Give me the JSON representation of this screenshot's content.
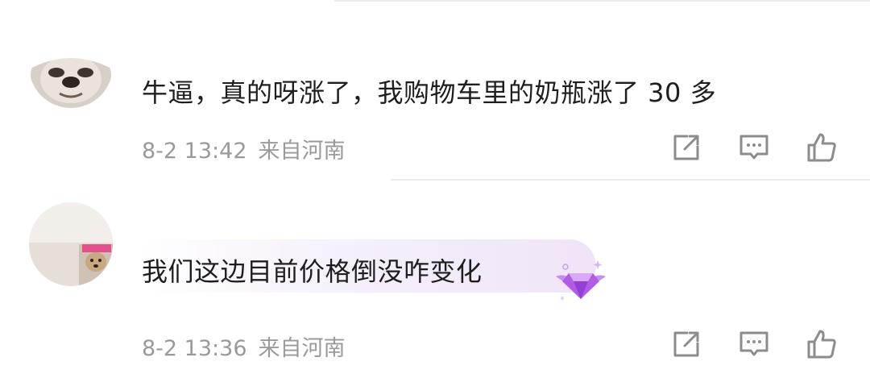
{
  "comments": [
    {
      "text": "牛逼，真的呀涨了，我购物车里的奶瓶涨了 30 多",
      "date": "8-2 13:42",
      "location": "来自河南"
    },
    {
      "text": "我们这边目前价格倒没咋变化",
      "date": "8-2 13:36",
      "location": "来自河南"
    }
  ],
  "icons": {
    "share": "share-icon",
    "reply": "reply-icon",
    "like": "thumbs-up-icon",
    "badge": "purple-diamond-badge-icon"
  },
  "colors": {
    "comment_text": "#1e1e1e",
    "meta_text": "#9a9a9a",
    "icon_stroke": "#8c8c8c",
    "badge_accent": "#b05ce6",
    "highlight_bg": "#f3eafb"
  }
}
